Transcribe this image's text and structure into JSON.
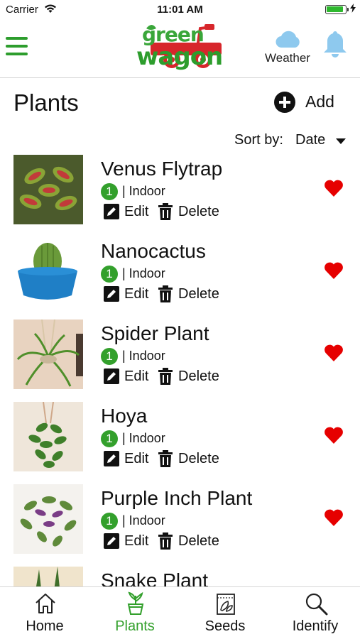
{
  "status_bar": {
    "carrier": "Carrier",
    "time": "11:01 AM",
    "battery_level": 0.9
  },
  "header": {
    "logo_top": "green",
    "logo_bottom": "wagon",
    "weather_label": "Weather",
    "icons": {
      "menu": "hamburger-menu-icon",
      "weather": "cloud-icon",
      "notifications": "bell-icon"
    }
  },
  "page": {
    "title": "Plants",
    "add_label": "Add",
    "sort_label": "Sort by:",
    "sort_value": "Date"
  },
  "plants": [
    {
      "name": "Venus Flytrap",
      "level": "1",
      "location": "| Indoor",
      "edit": "Edit",
      "delete": "Delete",
      "favorite": true
    },
    {
      "name": "Nanocactus",
      "level": "1",
      "location": "| Indoor",
      "edit": "Edit",
      "delete": "Delete",
      "favorite": true
    },
    {
      "name": "Spider Plant",
      "level": "1",
      "location": "| Indoor",
      "edit": "Edit",
      "delete": "Delete",
      "favorite": true
    },
    {
      "name": "Hoya",
      "level": "1",
      "location": "| Indoor",
      "edit": "Edit",
      "delete": "Delete",
      "favorite": true
    },
    {
      "name": "Purple Inch Plant",
      "level": "1",
      "location": "| Indoor",
      "edit": "Edit",
      "delete": "Delete",
      "favorite": true
    },
    {
      "name": "Snake Plant"
    }
  ],
  "tabs": [
    {
      "label": "Home",
      "icon": "home-icon",
      "active": false
    },
    {
      "label": "Plants",
      "icon": "potted-plant-icon",
      "active": true
    },
    {
      "label": "Seeds",
      "icon": "seed-packet-icon",
      "active": false
    },
    {
      "label": "Identify",
      "icon": "magnifier-icon",
      "active": false
    }
  ],
  "colors": {
    "brand_green": "#33a02c",
    "weather_blue": "#8ec9ee",
    "favorite_red": "#e60000",
    "logo_red": "#d7262b"
  }
}
